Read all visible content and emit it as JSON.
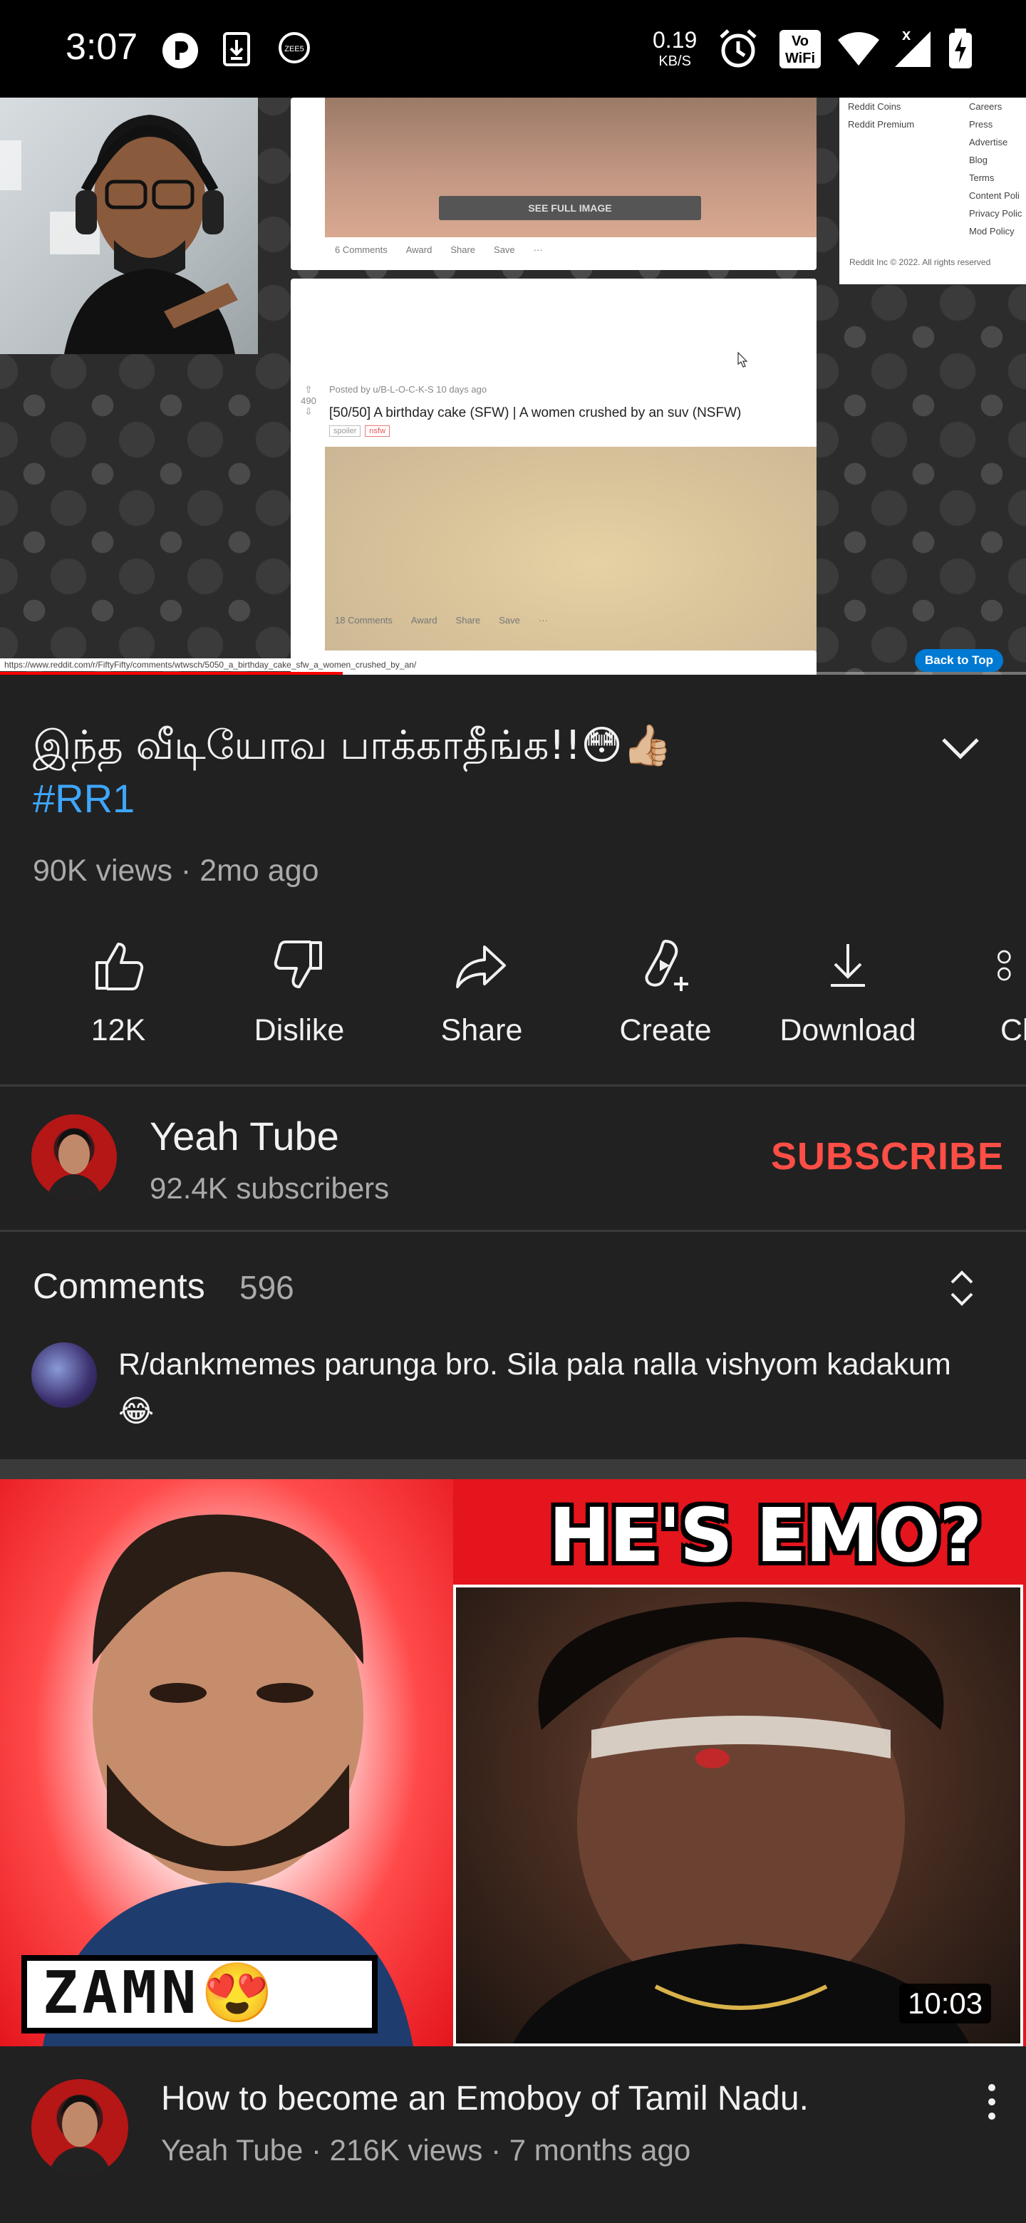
{
  "status_bar": {
    "time": "3:07",
    "net_speed_value": "0.19",
    "net_speed_unit": "KB/S",
    "vowifi_top": "Vo",
    "vowifi_bottom": "WiFi"
  },
  "player": {
    "progress_fraction": 0.334,
    "progress_color": "#ff0000",
    "screen": {
      "see_full_image": "SEE FULL IMAGE",
      "top_actions": [
        "6 Comments",
        "Award",
        "Share",
        "Save",
        "···"
      ],
      "post_header": "Posted by u/B-L-O-C-K-S 10 days ago",
      "vote_count": "490",
      "post_title": "[50/50] A birthday cake (SFW) | A women crushed by an suv (NSFW)",
      "tags": [
        "spoiler",
        "nsfw"
      ],
      "bottom_actions": [
        "18 Comments",
        "Award",
        "Share",
        "Save",
        "···"
      ],
      "sidebar_left": [
        "Reddit Coins",
        "Reddit Premium"
      ],
      "sidebar_right": [
        "Careers",
        "Press",
        "Advertise",
        "Blog",
        "Terms",
        "Content Poli",
        "Privacy Polic",
        "Mod Policy"
      ],
      "sidebar_footer": "Reddit Inc © 2022. All rights reserved",
      "back_to_top": "Back to Top",
      "url_strip": "https://www.reddit.com/r/FiftyFifty/comments/wtwsch/5050_a_birthday_cake_sfw_a_women_crushed_by_an/"
    }
  },
  "video": {
    "title": "இந்த வீடியோவ பாக்காதீங்க!!😳👍🏼",
    "hashtag": "#RR1",
    "meta": "90K views · 2mo ago"
  },
  "actions": [
    {
      "icon": "like-icon",
      "label": "12K"
    },
    {
      "icon": "dislike-icon",
      "label": "Dislike"
    },
    {
      "icon": "share-icon",
      "label": "Share"
    },
    {
      "icon": "create-icon",
      "label": "Create"
    },
    {
      "icon": "download-icon",
      "label": "Download"
    },
    {
      "icon": "clip-icon",
      "label": "Cl"
    }
  ],
  "channel": {
    "name": "Yeah Tube",
    "subscribers": "92.4K subscribers",
    "subscribe_label": "SUBSCRIBE",
    "subscribe_color": "#ff4e45"
  },
  "comments": {
    "title": "Comments",
    "count": "596",
    "top_comment": "R/dankmemes parunga bro. Sila pala nalla vishyom kadakum 😂"
  },
  "recommended": {
    "thumb_headline": "HE'S EMO?",
    "thumb_bubble": "ZAMN😍",
    "duration": "10:03",
    "title": "How to become an Emoboy of Tamil Nadu.",
    "meta": "Yeah Tube · 216K views · 7 months ago"
  }
}
